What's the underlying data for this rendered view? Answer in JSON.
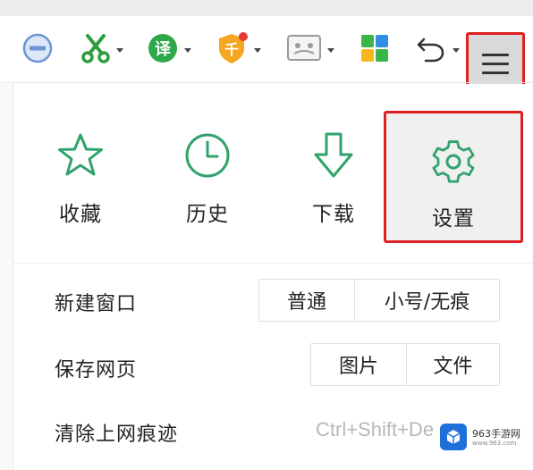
{
  "toolbar": {
    "tools": [
      {
        "name": "no-entry-icon"
      },
      {
        "name": "scissors-icon",
        "dropdown": true
      },
      {
        "name": "translate-icon",
        "glyph": "译",
        "dropdown": true
      },
      {
        "name": "shield-icon",
        "glyph": "千",
        "dropdown": true
      },
      {
        "name": "game-icon",
        "dropdown": true
      },
      {
        "name": "apps-grid-icon"
      },
      {
        "name": "undo-icon",
        "dropdown": true
      }
    ],
    "menu_icon": "hamburger-menu-icon"
  },
  "quick_actions": [
    {
      "label": "收藏",
      "icon": "star-icon"
    },
    {
      "label": "历史",
      "icon": "clock-icon"
    },
    {
      "label": "下载",
      "icon": "download-arrow-icon"
    },
    {
      "label": "设置",
      "icon": "gear-icon",
      "highlighted": true
    }
  ],
  "menu": {
    "new_window": {
      "label": "新建窗口",
      "options": [
        "普通",
        "小号/无痕"
      ]
    },
    "save_page": {
      "label": "保存网页",
      "options": [
        "图片",
        "文件"
      ]
    },
    "clear_traces": {
      "label": "清除上网痕迹",
      "shortcut": "Ctrl+Shift+Del"
    }
  },
  "watermark": {
    "title": "963手游网",
    "subtitle": "www.963.com"
  },
  "colors": {
    "accent_green": "#2fa36b",
    "highlight_red": "#e02020",
    "icon_blue": "#5b8fd8"
  }
}
